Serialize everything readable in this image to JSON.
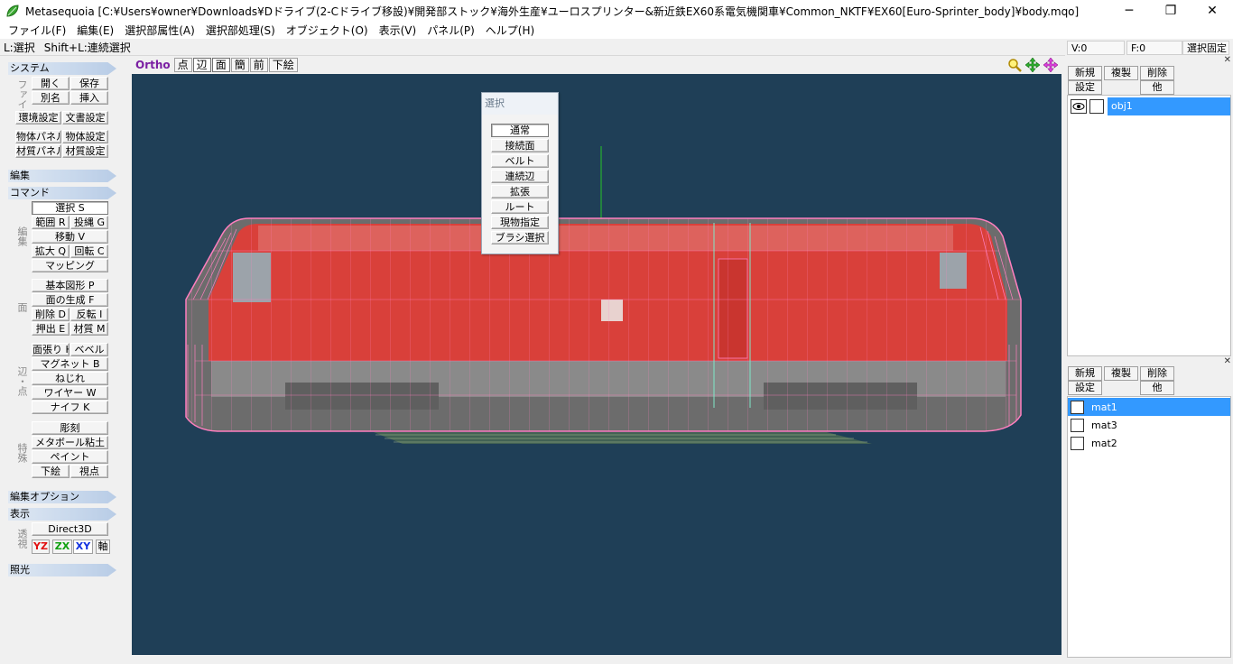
{
  "window": {
    "title": "Metasequoia [C:¥Users¥owner¥Downloads¥Dドライブ(2-Cドライブ移設)¥開発部ストック¥海外生産¥ユーロスプリンター&新近鉄EX60系電気機関車¥Common_NKTF¥EX60[Euro-Sprinter_body]¥body.mqo]",
    "minimize": "─",
    "maximize": "❐",
    "close": "✕"
  },
  "menu": [
    "ファイル(F)",
    "編集(E)",
    "選択部属性(A)",
    "選択部処理(S)",
    "オブジェクト(O)",
    "表示(V)",
    "パネル(P)",
    "ヘルプ(H)"
  ],
  "status": {
    "hint1": "L:選択",
    "hint2": "Shift+L:連続選択"
  },
  "left": {
    "system": {
      "header": "システム",
      "file_label": "ファイル",
      "open": "開く",
      "save": "保存",
      "rename": "別名",
      "insert": "挿入",
      "env": "環境設定",
      "docset": "文書設定",
      "objpanel": "物体パネル",
      "objset": "物体設定",
      "matpanel": "材質パネル",
      "matset": "材質設定"
    },
    "edit_header": "編集",
    "command": {
      "header": "コマンド",
      "edit_label": "編集",
      "select": "選択 S",
      "range": "範囲 R",
      "lasso": "投縄 G",
      "move": "移動 V",
      "scale": "拡大 Q",
      "rotate": "回転 C",
      "mapping": "マッピング",
      "face_label": "面",
      "primitive": "基本図形 P",
      "genface": "面の生成 F",
      "delete": "削除 D",
      "flip": "反転 I",
      "extrude": "押出 E",
      "material": "材質 M",
      "edge_label": "辺・点",
      "stretch": "面張り H",
      "bevel": "ベベル",
      "magnet": "マグネット B",
      "twist": "ねじれ",
      "wire": "ワイヤー W",
      "knife": "ナイフ K",
      "special_label": "特殊",
      "sculpt": "彫刻",
      "metaclay": "メタボール粘土",
      "paint": "ペイント",
      "underlay": "下絵",
      "viewpoint": "視点"
    },
    "editopt_header": "編集オプション",
    "display": {
      "header": "表示",
      "persp_label": "透視",
      "direct3d": "Direct3D",
      "yz": "YZ",
      "zx": "ZX",
      "xy": "XY",
      "axis": "軸"
    },
    "light_header": "照光"
  },
  "view": {
    "ortho": "Ortho",
    "modes": [
      "点",
      "辺",
      "面",
      "簡",
      "前",
      "下絵"
    ],
    "colors": {
      "background": "#1f3f57",
      "wire": "#ff7fbf",
      "body": "#d9403a",
      "grid": "#d8e6a8"
    }
  },
  "select_panel": {
    "title": "選択",
    "options": [
      "通常",
      "接続面",
      "ベルト",
      "連続辺",
      "拡張",
      "ルート",
      "現物指定",
      "ブラシ選択"
    ]
  },
  "right": {
    "v": "V:0",
    "f": "F:0",
    "lock": "選択固定",
    "obj_buttons": {
      "new": "新規",
      "dup": "複製",
      "del": "削除",
      "set": "設定",
      "other": "他"
    },
    "objects": [
      {
        "name": "obj1"
      }
    ],
    "mat_buttons": {
      "new": "新規",
      "dup": "複製",
      "del": "削除",
      "set": "設定",
      "other": "他"
    },
    "materials": [
      {
        "name": "mat1"
      },
      {
        "name": "mat3"
      },
      {
        "name": "mat2"
      }
    ]
  }
}
